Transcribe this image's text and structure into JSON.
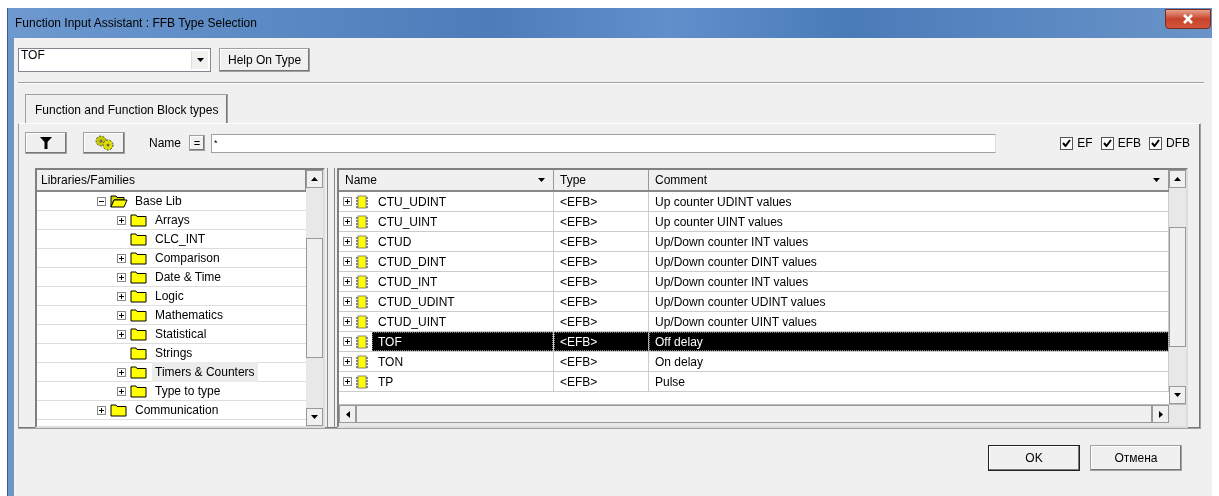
{
  "window": {
    "title": "Function Input Assistant : FFB Type Selection"
  },
  "type_combo": {
    "value": "TOF"
  },
  "help_button": {
    "label": "Help On Type"
  },
  "tabs": [
    {
      "label": "Function and Function Block types",
      "selected": true
    }
  ],
  "name_filter": {
    "label": "Name",
    "operator": "=",
    "value": "*"
  },
  "type_filters": [
    {
      "label": "EF",
      "checked": true
    },
    {
      "label": "EFB",
      "checked": true
    },
    {
      "label": "DFB",
      "checked": true
    }
  ],
  "tree": {
    "header": "Libraries/Families",
    "items": [
      {
        "label": "Base Lib",
        "expandable": true,
        "expanded": true,
        "selected": false,
        "children": [
          {
            "label": "Arrays",
            "expandable": true,
            "expanded": false,
            "selected": false
          },
          {
            "label": "CLC_INT",
            "expandable": false,
            "expanded": false,
            "selected": false
          },
          {
            "label": "Comparison",
            "expandable": true,
            "expanded": false,
            "selected": false
          },
          {
            "label": "Date & Time",
            "expandable": true,
            "expanded": false,
            "selected": false
          },
          {
            "label": "Logic",
            "expandable": true,
            "expanded": false,
            "selected": false
          },
          {
            "label": "Mathematics",
            "expandable": true,
            "expanded": false,
            "selected": false
          },
          {
            "label": "Statistical",
            "expandable": true,
            "expanded": false,
            "selected": false
          },
          {
            "label": "Strings",
            "expandable": false,
            "expanded": false,
            "selected": false
          },
          {
            "label": "Timers & Counters",
            "expandable": true,
            "expanded": false,
            "selected": true
          },
          {
            "label": "Type to type",
            "expandable": true,
            "expanded": false,
            "selected": false
          }
        ]
      },
      {
        "label": "Communication",
        "expandable": true,
        "expanded": false,
        "selected": false
      }
    ]
  },
  "table": {
    "columns": [
      {
        "label": "Name",
        "dropdown": true
      },
      {
        "label": "Type",
        "dropdown": false
      },
      {
        "label": "Comment",
        "dropdown": true
      }
    ],
    "rows": [
      {
        "name": "CTU_UDINT",
        "type": "<EFB>",
        "comment": "Up counter UDINT values",
        "selected": false
      },
      {
        "name": "CTU_UINT",
        "type": "<EFB>",
        "comment": "Up counter UINT values",
        "selected": false
      },
      {
        "name": "CTUD",
        "type": "<EFB>",
        "comment": "Up/Down counter INT values",
        "selected": false
      },
      {
        "name": "CTUD_DINT",
        "type": "<EFB>",
        "comment": "Up/Down counter DINT values",
        "selected": false
      },
      {
        "name": "CTUD_INT",
        "type": "<EFB>",
        "comment": "Up/Down counter INT values",
        "selected": false
      },
      {
        "name": "CTUD_UDINT",
        "type": "<EFB>",
        "comment": "Up/Down counter UDINT values",
        "selected": false
      },
      {
        "name": "CTUD_UINT",
        "type": "<EFB>",
        "comment": "Up/Down counter UINT values",
        "selected": false
      },
      {
        "name": "TOF",
        "type": "<EFB>",
        "comment": "Off delay",
        "selected": true
      },
      {
        "name": "TON",
        "type": "<EFB>",
        "comment": "On delay",
        "selected": false
      },
      {
        "name": "TP",
        "type": "<EFB>",
        "comment": "Pulse",
        "selected": false
      }
    ]
  },
  "buttons": [
    {
      "label": "OK",
      "default": true
    },
    {
      "label": "Отмена",
      "default": false
    }
  ]
}
